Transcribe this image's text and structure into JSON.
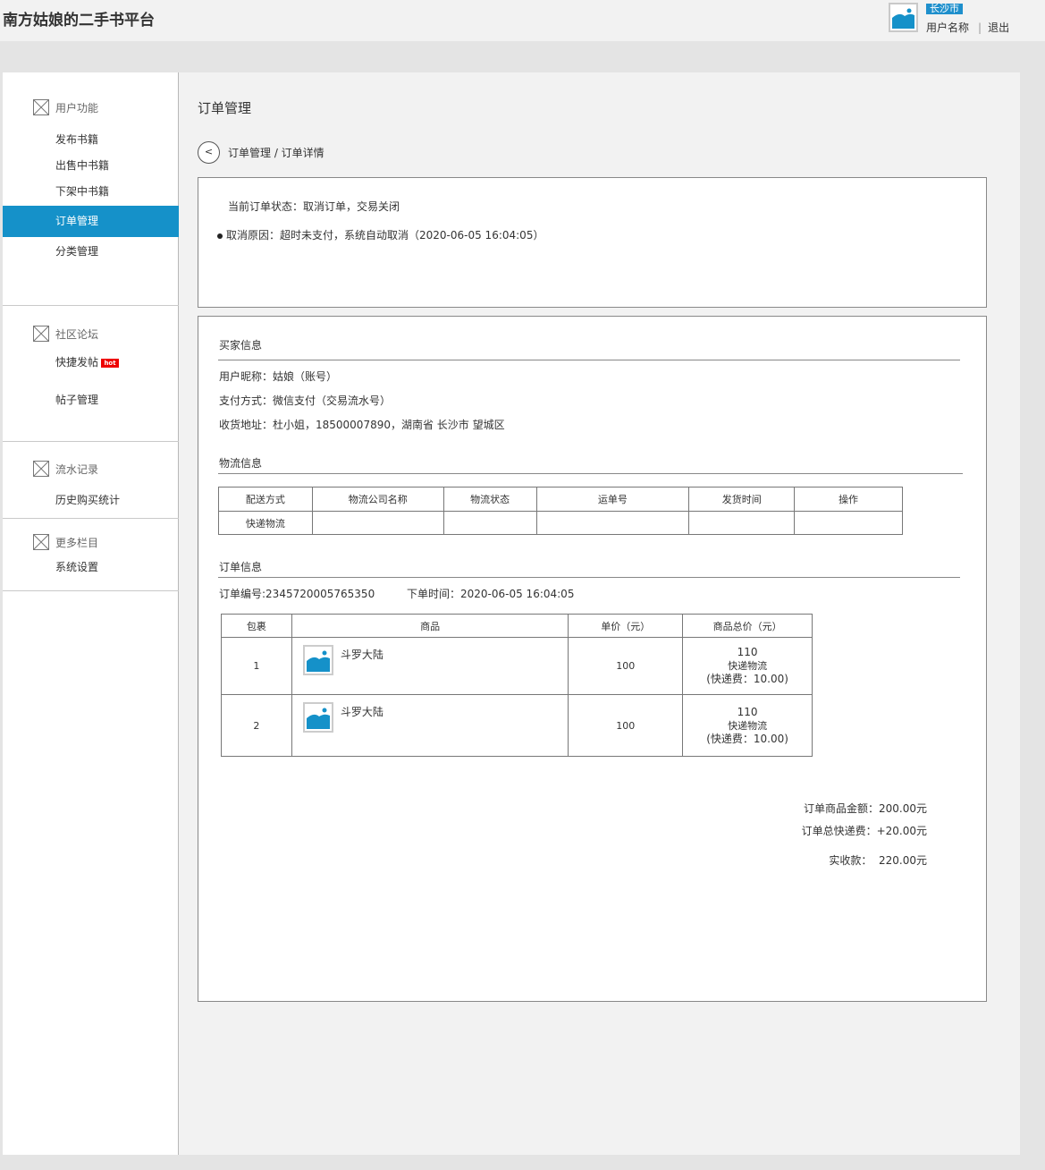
{
  "header": {
    "app_title": "南方姑娘的二手书平台",
    "city": "长沙市",
    "username": "用户名称",
    "logout": "退出",
    "avatar_icon": "image-placeholder-icon"
  },
  "sidebar": {
    "groups": [
      {
        "label": "用户功能",
        "icon": "box-x-icon",
        "items": [
          "发布书籍",
          "出售中书籍",
          "下架中书籍",
          "订单管理",
          "分类管理"
        ],
        "active": "订单管理"
      },
      {
        "label": "社区论坛",
        "icon": "box-x-icon",
        "items": [
          "快捷发帖",
          "帖子管理"
        ],
        "hot_tag": "hot"
      },
      {
        "label": "流水记录",
        "icon": "box-x-icon",
        "items": [
          "历史购买统计"
        ]
      },
      {
        "label": "更多栏目",
        "icon": "box-x-icon",
        "items": [
          "系统设置"
        ]
      }
    ]
  },
  "main": {
    "page_title": "订单管理",
    "back_glyph": "<",
    "breadcrumb": "订单管理 / 订单详情",
    "status": {
      "current": "当前订单状态：取消订单，交易关闭",
      "reason": "取消原因：超时未支付，系统自动取消（2020-06-05 16:04:05）"
    },
    "buyer": {
      "title": "买家信息",
      "nickname": "用户昵称：姑娘（账号）",
      "payment": "支付方式：微信支付（交易流水号）",
      "address": "收货地址：杜小姐，18500007890，湖南省 长沙市 望城区"
    },
    "logistics": {
      "title": "物流信息",
      "columns": [
        "配送方式",
        "物流公司名称",
        "物流状态",
        "运单号",
        "发货时间",
        "操作"
      ],
      "rows": [
        [
          "快递物流",
          "",
          "",
          "",
          "",
          ""
        ]
      ]
    },
    "order": {
      "title": "订单信息",
      "order_no": "订单编号:2345720005765350",
      "order_time": "下单时间：2020-06-05 16:04:05",
      "columns": [
        "包裹",
        "商品",
        "单价（元）",
        "商品总价（元）"
      ],
      "rows": [
        {
          "package": "1",
          "product": "斗罗大陆",
          "price": "100",
          "total": "110",
          "shipping": "快递物流",
          "fee": "(快递费：10.00)"
        },
        {
          "package": "2",
          "product": "斗罗大陆",
          "price": "100",
          "total": "110",
          "shipping": "快递物流",
          "fee": "(快递费：10.00)"
        }
      ]
    },
    "summary": {
      "goods_amount": "订单商品金额：200.00元",
      "shipping_total": "订单总快递费：+20.00元",
      "received": "实收款：  220.00元"
    }
  },
  "colors": {
    "accent": "#1591c9",
    "badge": "#1e8fcc",
    "hot": "#ee0000"
  }
}
